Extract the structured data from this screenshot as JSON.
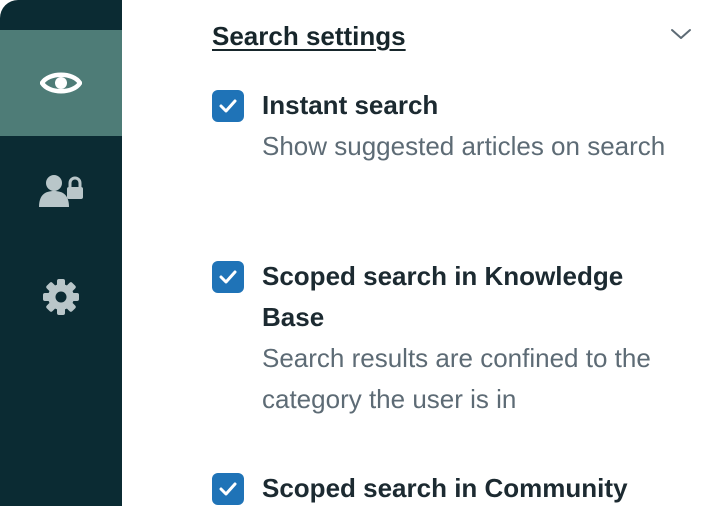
{
  "sidebar": {
    "items": [
      {
        "icon": "eye-icon",
        "active": true
      },
      {
        "icon": "user-lock-icon",
        "active": false
      },
      {
        "icon": "gear-icon",
        "active": false
      }
    ]
  },
  "section": {
    "title": "Search settings",
    "expand_icon": "chevron-down-icon"
  },
  "options": [
    {
      "title": "Instant search",
      "description": "Show suggested articles on search",
      "checked": true
    },
    {
      "title": "Scoped search in Knowledge Base",
      "description": "Search results are confined to the category the user is in",
      "checked": true
    },
    {
      "title": "Scoped search in Community",
      "description": "",
      "checked": true
    }
  ],
  "colors": {
    "sidebar_bg": "#0b2b33",
    "sidebar_active": "#4e7c77",
    "checkbox": "#1f73b7"
  }
}
